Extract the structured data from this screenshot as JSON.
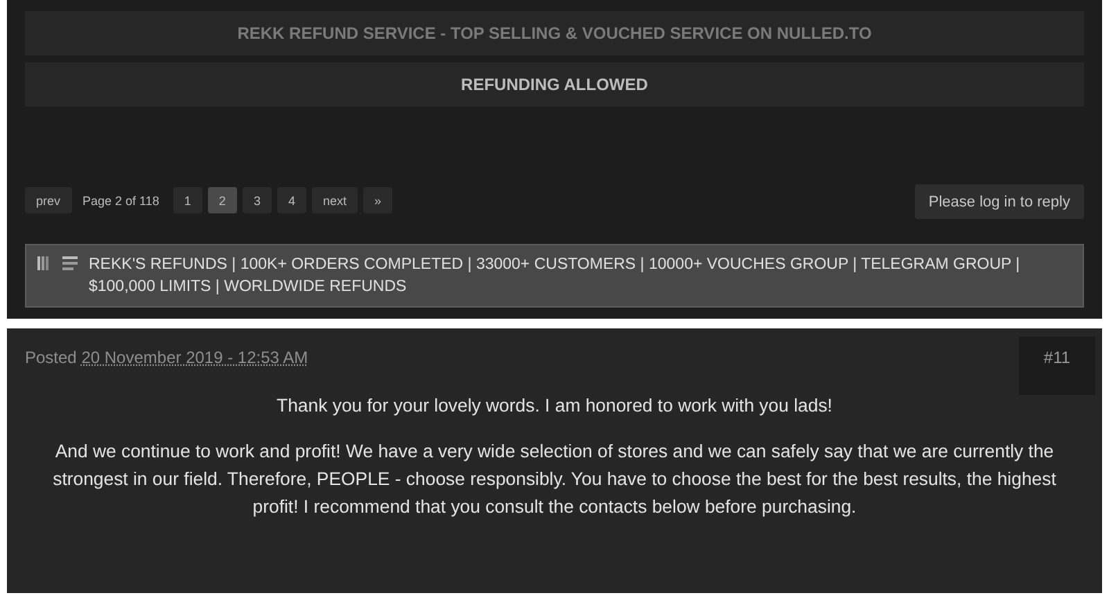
{
  "top_panel": {
    "banners": [
      {
        "text": "REKK REFUND SERVICE - TOP SELLING & VOUCHED SERVICE ON NULLED.TO",
        "dim": true
      },
      {
        "text": "REFUNDING ALLOWED",
        "dim": false
      }
    ],
    "pagination": {
      "prev": "prev",
      "info": "Page 2 of 118",
      "pages": [
        {
          "label": "1",
          "selected": false
        },
        {
          "label": "2",
          "selected": true
        },
        {
          "label": "3",
          "selected": false
        },
        {
          "label": "4",
          "selected": false
        }
      ],
      "next": "next",
      "last": "»"
    },
    "reply_button": "Please log in to reply",
    "thread_bar": {
      "lines": [
        "REKK'S REFUNDS | 100K+ ORDERS COMPLETED | 33000+ CUSTOMERS | 10000+ VOUCHES GROUP | TELEGRAM GROUP |",
        "$100,000 LIMITS | WORLDWIDE REFUNDS"
      ]
    }
  },
  "post": {
    "posted_label": "Posted",
    "date": "20 November 2019 - 12:53 AM",
    "number": "#11",
    "paragraphs": [
      "Thank you for your lovely words. I am honored to work with you lads!",
      "And we continue to work and profit! We have a very wide selection of stores and we can safely say that we are currently the strongest in our field. Therefore, PEOPLE - choose responsibly. You have to choose the best for the best results, the highest profit! I recommend that you consult the contacts below before purchasing."
    ]
  }
}
